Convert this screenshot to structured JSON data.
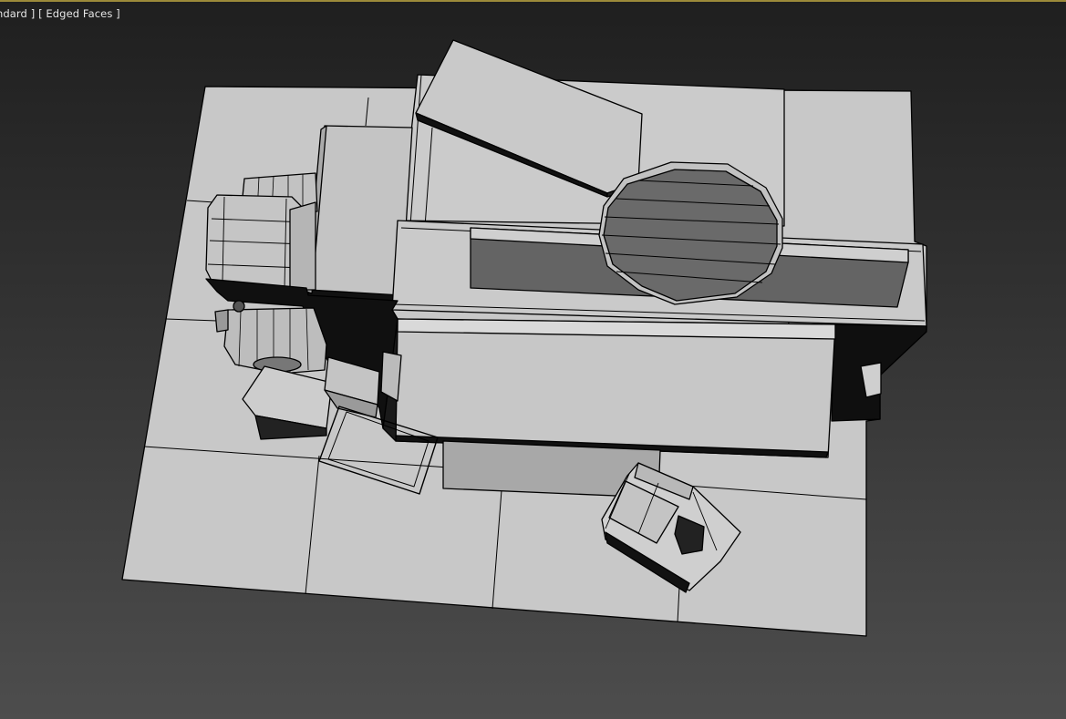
{
  "viewport": {
    "label_shading": "ndard ]",
    "label_edges": "[ Edged Faces ]",
    "background_top": "#1f1f1f",
    "background_bottom": "#4d4d4d",
    "active_border_color": "#9c8a3a"
  },
  "scene": {
    "face_color_light": "#c9c9c9",
    "face_color_mid": "#a6a6a6",
    "face_color_dark": "#666666",
    "edge_color": "#000000"
  }
}
